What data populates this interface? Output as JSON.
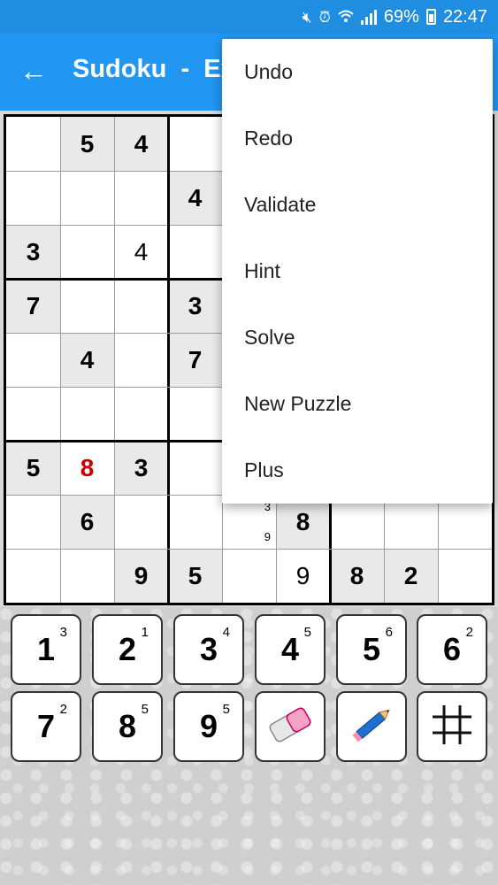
{
  "status": {
    "battery": "69%",
    "time": "22:47",
    "icons": [
      "mute-icon",
      "alarm-icon",
      "wifi-icon",
      "signal-icon",
      "battery-icon"
    ]
  },
  "appbar": {
    "back_icon": "back-arrow-icon",
    "title": "Sudoku  -  Ex"
  },
  "board": {
    "rows": [
      [
        {
          "v": "",
          "t": "empty"
        },
        {
          "v": "5",
          "t": "given"
        },
        {
          "v": "4",
          "t": "given"
        },
        {
          "v": "",
          "t": "empty"
        },
        {
          "v": "",
          "t": "hidden"
        },
        {
          "v": "",
          "t": "hidden"
        },
        {
          "v": "",
          "t": "hidden"
        },
        {
          "v": "",
          "t": "hidden"
        },
        {
          "v": "",
          "t": "hidden"
        }
      ],
      [
        {
          "v": "",
          "t": "empty"
        },
        {
          "v": "",
          "t": "empty"
        },
        {
          "v": "",
          "t": "empty"
        },
        {
          "v": "4",
          "t": "given"
        },
        {
          "v": "",
          "t": "hidden"
        },
        {
          "v": "",
          "t": "hidden"
        },
        {
          "v": "",
          "t": "hidden"
        },
        {
          "v": "",
          "t": "hidden"
        },
        {
          "v": "",
          "t": "hidden"
        }
      ],
      [
        {
          "v": "3",
          "t": "given"
        },
        {
          "v": "",
          "t": "empty"
        },
        {
          "v": "4",
          "t": "user"
        },
        {
          "v": "",
          "t": "empty"
        },
        {
          "v": "",
          "t": "hidden"
        },
        {
          "v": "",
          "t": "hidden"
        },
        {
          "v": "",
          "t": "hidden"
        },
        {
          "v": "",
          "t": "hidden"
        },
        {
          "v": "",
          "t": "hidden"
        }
      ],
      [
        {
          "v": "7",
          "t": "given"
        },
        {
          "v": "",
          "t": "empty"
        },
        {
          "v": "",
          "t": "empty"
        },
        {
          "v": "3",
          "t": "given"
        },
        {
          "v": "",
          "t": "hidden"
        },
        {
          "v": "",
          "t": "hidden"
        },
        {
          "v": "",
          "t": "hidden"
        },
        {
          "v": "",
          "t": "hidden"
        },
        {
          "v": "",
          "t": "hidden"
        }
      ],
      [
        {
          "v": "",
          "t": "empty"
        },
        {
          "v": "4",
          "t": "given"
        },
        {
          "v": "",
          "t": "empty"
        },
        {
          "v": "7",
          "t": "given"
        },
        {
          "v": "",
          "t": "hidden"
        },
        {
          "v": "",
          "t": "hidden"
        },
        {
          "v": "",
          "t": "hidden"
        },
        {
          "v": "",
          "t": "hidden"
        },
        {
          "v": "",
          "t": "hidden"
        }
      ],
      [
        {
          "v": "",
          "t": "empty"
        },
        {
          "v": "",
          "t": "empty"
        },
        {
          "v": "",
          "t": "empty"
        },
        {
          "v": "",
          "t": "empty"
        },
        {
          "v": "",
          "t": "hidden"
        },
        {
          "v": "",
          "t": "hidden"
        },
        {
          "v": "",
          "t": "hidden"
        },
        {
          "v": "",
          "t": "hidden"
        },
        {
          "v": "",
          "t": "hidden"
        }
      ],
      [
        {
          "v": "5",
          "t": "given"
        },
        {
          "v": "8",
          "t": "error"
        },
        {
          "v": "3",
          "t": "given"
        },
        {
          "v": "",
          "t": "empty"
        },
        {
          "v": "",
          "t": "hidden"
        },
        {
          "v": "",
          "t": "hidden"
        },
        {
          "v": "",
          "t": "hidden"
        },
        {
          "v": "",
          "t": "hidden"
        },
        {
          "v": "",
          "t": "hidden"
        }
      ],
      [
        {
          "v": "",
          "t": "empty"
        },
        {
          "v": "6",
          "t": "given"
        },
        {
          "v": "",
          "t": "empty"
        },
        {
          "v": "",
          "t": "empty"
        },
        {
          "v": "",
          "t": "notes",
          "notes": [
            "3",
            "9"
          ]
        },
        {
          "v": "8",
          "t": "given"
        },
        {
          "v": "",
          "t": "empty"
        },
        {
          "v": "",
          "t": "empty"
        },
        {
          "v": "",
          "t": "empty"
        }
      ],
      [
        {
          "v": "",
          "t": "empty"
        },
        {
          "v": "",
          "t": "empty"
        },
        {
          "v": "9",
          "t": "given"
        },
        {
          "v": "5",
          "t": "given"
        },
        {
          "v": "",
          "t": "empty"
        },
        {
          "v": "9",
          "t": "user"
        },
        {
          "v": "8",
          "t": "given"
        },
        {
          "v": "2",
          "t": "given"
        },
        {
          "v": "",
          "t": "empty"
        }
      ]
    ]
  },
  "keypad": {
    "digits": [
      {
        "label": "1",
        "count": "3"
      },
      {
        "label": "2",
        "count": "1"
      },
      {
        "label": "3",
        "count": "4"
      },
      {
        "label": "4",
        "count": "5"
      },
      {
        "label": "5",
        "count": "6"
      },
      {
        "label": "6",
        "count": "2"
      },
      {
        "label": "7",
        "count": "2"
      },
      {
        "label": "8",
        "count": "5"
      },
      {
        "label": "9",
        "count": "5"
      }
    ],
    "tools": [
      "eraser-icon",
      "pencil-icon",
      "grid-icon"
    ]
  },
  "menu": {
    "items": [
      "Undo",
      "Redo",
      "Validate",
      "Hint",
      "Solve",
      "New Puzzle",
      "Plus"
    ]
  }
}
